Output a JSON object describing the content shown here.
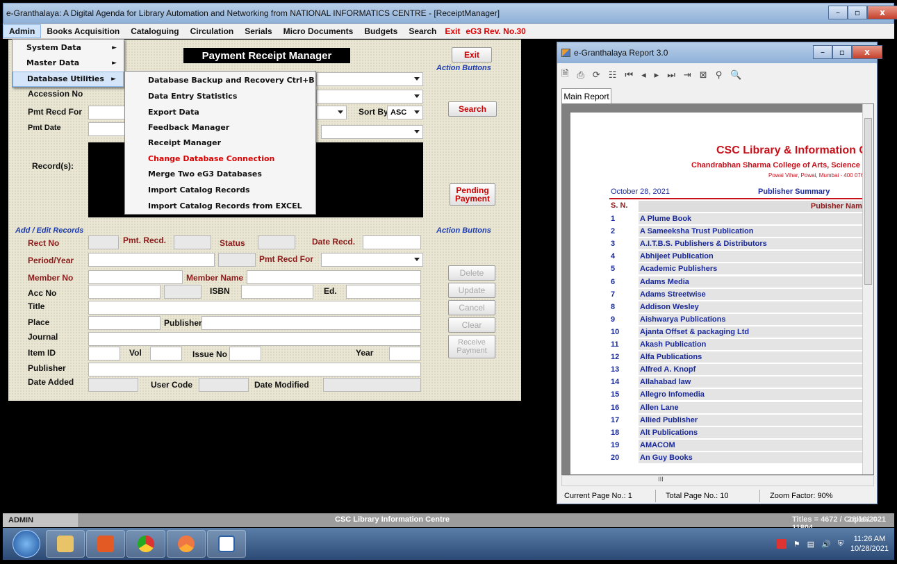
{
  "main_window": {
    "title": "e-Granthalaya: A Digital Agenda for Library Automation and Networking from NATIONAL INFORMATICS CENTRE - [ReceiptManager]",
    "min": "–",
    "max": "▫",
    "close": "x"
  },
  "menubar": {
    "items": [
      "Admin",
      "Books Acquisition",
      "Cataloguing",
      "Circulation",
      "Serials",
      "Micro Documents",
      "Budgets",
      "Search"
    ],
    "exit": "Exit",
    "version": "eG3 Rev. No.30"
  },
  "admin_menu": {
    "items": [
      {
        "label": "System Data",
        "sub": "►"
      },
      {
        "label": "Master Data",
        "sub": "►"
      },
      {
        "label": "Database Utilities",
        "sub": "►"
      }
    ]
  },
  "db_utilities_menu": {
    "items": [
      "Database Backup and Recovery   Ctrl+B",
      "Data Entry Statistics",
      "Export Data",
      "Feedback Manager",
      "Receipt Manager",
      "Change Database Connection",
      "Merge Two eG3 Databases",
      "Import Catalog Records",
      "Import Catalog Records from EXCEL"
    ]
  },
  "form": {
    "title": "Payment Receipt Manager",
    "accession_no": "Accession No",
    "pmt_recd_for": "Pmt Recd For",
    "pmt_date": "Pmt Date",
    "sort_by": "Sort By",
    "sort_value": "ASC",
    "records": "Record(s):",
    "exit_btn": "Exit",
    "action_buttons_1": "Action Buttons",
    "search_btn": "Search",
    "pending_btn": "Pending Payment",
    "add_edit": "Add / Edit Records",
    "action_buttons_2": "Action Buttons",
    "rect_no": "Rect No",
    "pmt_recd": "Pmt. Recd.",
    "status": "Status",
    "date_recd": "Date Recd.",
    "period_year": "Period/Year",
    "pmt_recd_for_2": "Pmt Recd For",
    "member_no": "Member No",
    "member_name": "Member Name",
    "acc_no": "Acc No",
    "isbn": "ISBN",
    "ed": "Ed.",
    "title_lbl": "Title",
    "place": "Place",
    "publisher": "Publisher",
    "journal": "Journal",
    "item_id": "Item ID",
    "vol": "Vol",
    "issue_no": "Issue No",
    "year": "Year",
    "publisher_2": "Publisher",
    "date_added": "Date Added",
    "user_code": "User Code",
    "date_modified": "Date Modified",
    "delete_btn": "Delete",
    "update_btn": "Update",
    "cancel_btn": "Cancel",
    "clear_btn": "Clear",
    "receive_btn": "Receive Payment"
  },
  "report_window": {
    "title": "e-Granthalaya Report 3.0",
    "tab": "Main Report",
    "toolbar_icons": [
      "export-icon",
      "print-icon",
      "refresh-icon",
      "tree-icon",
      "first-page-icon",
      "prev-page-icon",
      "next-page-icon",
      "last-page-icon",
      "goto-page-icon",
      "stop-icon",
      "find-icon",
      "zoom-icon"
    ],
    "org_name": "CSC Library & Information C",
    "college": "Chandrabhan Sharma College of Arts, Science a",
    "address": "Powai Vihar, Powai, Mumbai - 400 076",
    "date": "October 28, 2021",
    "summary_title": "Publisher Summary",
    "col_sn": "S. N.",
    "col_name": "Pubisher Name",
    "rows": [
      {
        "n": "1",
        "name": "A Plume Book"
      },
      {
        "n": "2",
        "name": "A Sameeksha Trust Publication"
      },
      {
        "n": "3",
        "name": "A.I.T.B.S. Publishers & Distributors"
      },
      {
        "n": "4",
        "name": "Abhijeet Publication"
      },
      {
        "n": "5",
        "name": "Academic Publishers"
      },
      {
        "n": "6",
        "name": "Adams Media"
      },
      {
        "n": "7",
        "name": "Adams Streetwise"
      },
      {
        "n": "8",
        "name": "Addison Wesley"
      },
      {
        "n": "9",
        "name": "Aishwarya Publications"
      },
      {
        "n": "10",
        "name": "Ajanta Offset & packaging Ltd"
      },
      {
        "n": "11",
        "name": "Akash Publication"
      },
      {
        "n": "12",
        "name": "Alfa Publications"
      },
      {
        "n": "13",
        "name": "Alfred A. Knopf"
      },
      {
        "n": "14",
        "name": "Allahabad law"
      },
      {
        "n": "15",
        "name": "Allegro Infomedia"
      },
      {
        "n": "16",
        "name": "Allen Lane"
      },
      {
        "n": "17",
        "name": "Allied Publisher"
      },
      {
        "n": "18",
        "name": "Alt Publications"
      },
      {
        "n": "19",
        "name": "AMACOM"
      },
      {
        "n": "20",
        "name": "An Guy Books"
      }
    ],
    "current_page": "Current Page No.: 1",
    "total_page": "Total Page No.: 10",
    "zoom": "Zoom Factor: 90%",
    "hscroll_mark": "III"
  },
  "status_bar": {
    "user": "ADMIN",
    "center": "CSC Library  Information Centre",
    "counts": "Titles = 4672 / Copies = 11804",
    "date": "28/10/2021"
  },
  "taskbar": {
    "time": "11:26 AM",
    "date": "10/28/2021",
    "apps": [
      "file-explorer-icon",
      "office-icon",
      "chrome-icon",
      "chrome-canary-icon",
      "nic-app-icon"
    ]
  }
}
